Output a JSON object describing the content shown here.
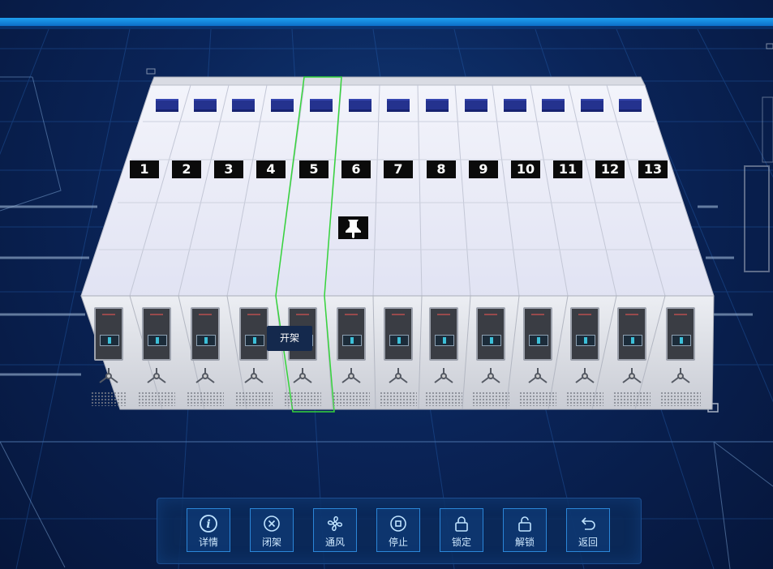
{
  "rack": {
    "columns": [
      "1",
      "2",
      "3",
      "4",
      "5",
      "6",
      "7",
      "8",
      "9",
      "10",
      "11",
      "12",
      "13"
    ],
    "selected_column": 5
  },
  "tooltip": {
    "label": "开架"
  },
  "toolbar": {
    "buttons": [
      {
        "label": "详情",
        "icon": "info-icon"
      },
      {
        "label": "闭架",
        "icon": "close-circle-icon"
      },
      {
        "label": "通风",
        "icon": "fan-icon"
      },
      {
        "label": "停止",
        "icon": "stop-icon"
      },
      {
        "label": "锁定",
        "icon": "lock-icon"
      },
      {
        "label": "解锁",
        "icon": "unlock-icon"
      },
      {
        "label": "返回",
        "icon": "return-icon"
      }
    ]
  },
  "colors": {
    "accent": "#2b86d8",
    "top_bar": "#1fa0f0",
    "selection_outline": "#36d43c",
    "background": "#0a2458"
  }
}
